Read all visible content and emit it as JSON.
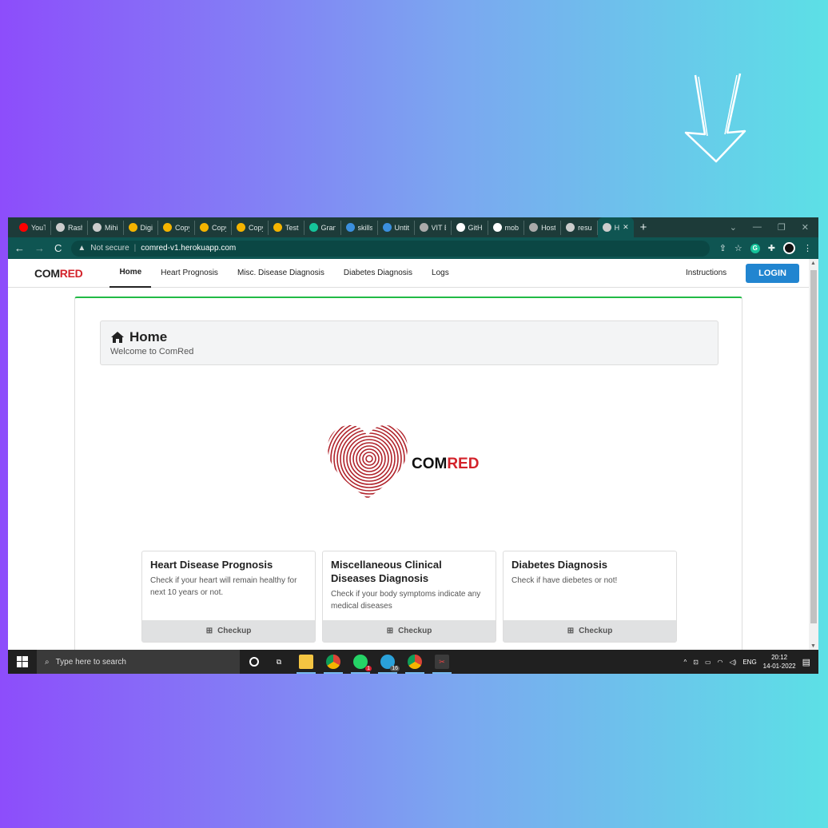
{
  "colors": {
    "accent": "#2185d0",
    "brand_red": "#d3222a",
    "segment_top": "#21ba45"
  },
  "browser": {
    "tabs": [
      {
        "label": "YouT",
        "icon": "youtube-icon",
        "color": "#ff0000"
      },
      {
        "label": "Rash",
        "icon": "globe-icon",
        "color": "#cccccc"
      },
      {
        "label": "Mihi",
        "icon": "globe-icon",
        "color": "#cccccc"
      },
      {
        "label": "Digi",
        "icon": "slides-icon",
        "color": "#f4b400"
      },
      {
        "label": "Copy",
        "icon": "slides-icon",
        "color": "#f4b400"
      },
      {
        "label": "Copy",
        "icon": "slides-icon",
        "color": "#f4b400"
      },
      {
        "label": "Copy",
        "icon": "slides-icon",
        "color": "#f4b400"
      },
      {
        "label": "Test",
        "icon": "slides-icon",
        "color": "#f4b400"
      },
      {
        "label": "Gran",
        "icon": "grammarly-icon",
        "color": "#15c39a"
      },
      {
        "label": "skills",
        "icon": "edge-icon",
        "color": "#3b8fde"
      },
      {
        "label": "Untit",
        "icon": "edge-icon",
        "color": "#3b8fde"
      },
      {
        "label": "VIT E",
        "icon": "car-icon",
        "color": "#aaaaaa"
      },
      {
        "label": "GitH",
        "icon": "github-icon",
        "color": "#ffffff"
      },
      {
        "label": "mob",
        "icon": "google-icon",
        "color": "#ffffff"
      },
      {
        "label": "Host",
        "icon": "car-icon",
        "color": "#aaaaaa"
      },
      {
        "label": "resu",
        "icon": "globe-icon",
        "color": "#cccccc"
      },
      {
        "label": "H",
        "icon": "globe-icon",
        "color": "#cccccc",
        "active": true
      }
    ],
    "new_tab": "+",
    "not_secure": "Not secure",
    "url": "comred-v1.herokuapp.com"
  },
  "navbar": {
    "brand_part1": "COM",
    "brand_part2": "RED",
    "items": [
      "Home",
      "Heart Prognosis",
      "Misc. Disease Diagnosis",
      "Diabetes Diagnosis",
      "Logs"
    ],
    "instructions": "Instructions",
    "login": "LOGIN"
  },
  "header": {
    "title": "Home",
    "subtitle": "Welcome to ComRed"
  },
  "logo": {
    "text1": "COM",
    "text2": "RED"
  },
  "cards": [
    {
      "title": "Heart Disease Prognosis",
      "desc": "Check if your heart will remain healthy for next 10 years or not.",
      "button": "Checkup"
    },
    {
      "title": "Miscellaneous Clinical Diseases Diagnosis",
      "desc": "Check if your body symptoms indicate any medical diseases",
      "button": "Checkup"
    },
    {
      "title": "Diabetes Diagnosis",
      "desc": "Check if have diebetes or not!",
      "button": "Checkup"
    }
  ],
  "taskbar": {
    "search_placeholder": "Type here to search",
    "whatsapp_badge": "1",
    "telegram_badge": "16",
    "lang": "ENG",
    "time": "20:12",
    "date": "14-01-2022"
  }
}
